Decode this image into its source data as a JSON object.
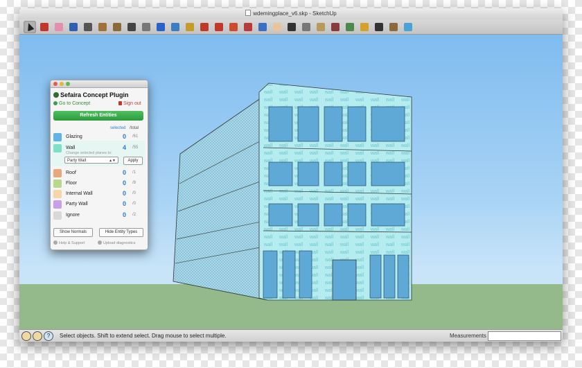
{
  "window": {
    "title": "wdemingplace_v6.skp - SketchUp"
  },
  "toolbar": {
    "tools": [
      {
        "name": "select-arrow-icon",
        "color": "#222222"
      },
      {
        "name": "pencil-line-icon",
        "color": "#c0392b"
      },
      {
        "name": "eraser-icon",
        "color": "#e58fb0"
      },
      {
        "name": "axes-icon",
        "color": "#2f5fb3"
      },
      {
        "name": "move-icon",
        "color": "#555555"
      },
      {
        "name": "rectangle-icon",
        "color": "#a0723a"
      },
      {
        "name": "circle-icon",
        "color": "#8b6a3a"
      },
      {
        "name": "arc-icon",
        "color": "#444444"
      },
      {
        "name": "push-pull-icon",
        "color": "#777777"
      },
      {
        "name": "info-icon",
        "color": "#2a62c8"
      },
      {
        "name": "paint-bucket-icon",
        "color": "#3a7fc4"
      },
      {
        "name": "tape-measure-icon",
        "color": "#c59b2b"
      },
      {
        "name": "offset-icon",
        "color": "#c0392b"
      },
      {
        "name": "follow-me-icon",
        "color": "#c0392b"
      },
      {
        "name": "rotate-icon",
        "color": "#d04b2b"
      },
      {
        "name": "orbit-icon",
        "color": "#b83a3a"
      },
      {
        "name": "pan-icon",
        "color": "#3d6fc6"
      },
      {
        "name": "hand-icon",
        "color": "#e8c59a"
      },
      {
        "name": "zoom-icon",
        "color": "#333333"
      },
      {
        "name": "zoom-extents-icon",
        "color": "#777777"
      },
      {
        "name": "section-plane-icon",
        "color": "#b89b5a"
      },
      {
        "name": "person-icon",
        "color": "#8a3a3a"
      },
      {
        "name": "walk-icon",
        "color": "#4a8a4a"
      },
      {
        "name": "tag-icon",
        "color": "#d6a12a"
      },
      {
        "name": "component-icon",
        "color": "#333333"
      },
      {
        "name": "warehouse-icon",
        "color": "#8a6a3a"
      },
      {
        "name": "share-icon",
        "color": "#4aa3d8"
      }
    ]
  },
  "plugin": {
    "title": "Sefaira Concept Plugin",
    "go_to_concept": "Go to Concept",
    "sign_out": "Sign out",
    "refresh_label": "Refresh Entities",
    "col_selected": "selected",
    "col_total": "/total",
    "change_hint": "Change selected planes to:",
    "select_value": "Party Wall",
    "apply_label": "Apply",
    "show_normals": "Show Normals",
    "hide_entity_types": "Hide Entity Types",
    "help_support": "Help & Support",
    "upload_diagnostics": "Upload diagnostics",
    "rows": [
      {
        "label": "Glazing",
        "selected": "0",
        "total": "/61",
        "color": "#5fb3e8"
      },
      {
        "label": "Wall",
        "selected": "4",
        "total": "/55",
        "color": "#7fe0c8"
      },
      {
        "label": "Roof",
        "selected": "0",
        "total": "/1",
        "color": "#e8a87a"
      },
      {
        "label": "Floor",
        "selected": "0",
        "total": "/8",
        "color": "#b8d88a"
      },
      {
        "label": "Internal Wall",
        "selected": "0",
        "total": "/0",
        "color": "#f5d6a8"
      },
      {
        "label": "Party Wall",
        "selected": "0",
        "total": "/0",
        "color": "#c8a0e8"
      },
      {
        "label": "Ignore",
        "selected": "0",
        "total": "/2",
        "color": "#d8d8d8"
      }
    ]
  },
  "model": {
    "wall_text": "wall"
  },
  "status": {
    "text": "Select objects. Shift to extend select. Drag mouse to select multiple.",
    "measurements_label": "Measurements",
    "measurements_value": ""
  }
}
